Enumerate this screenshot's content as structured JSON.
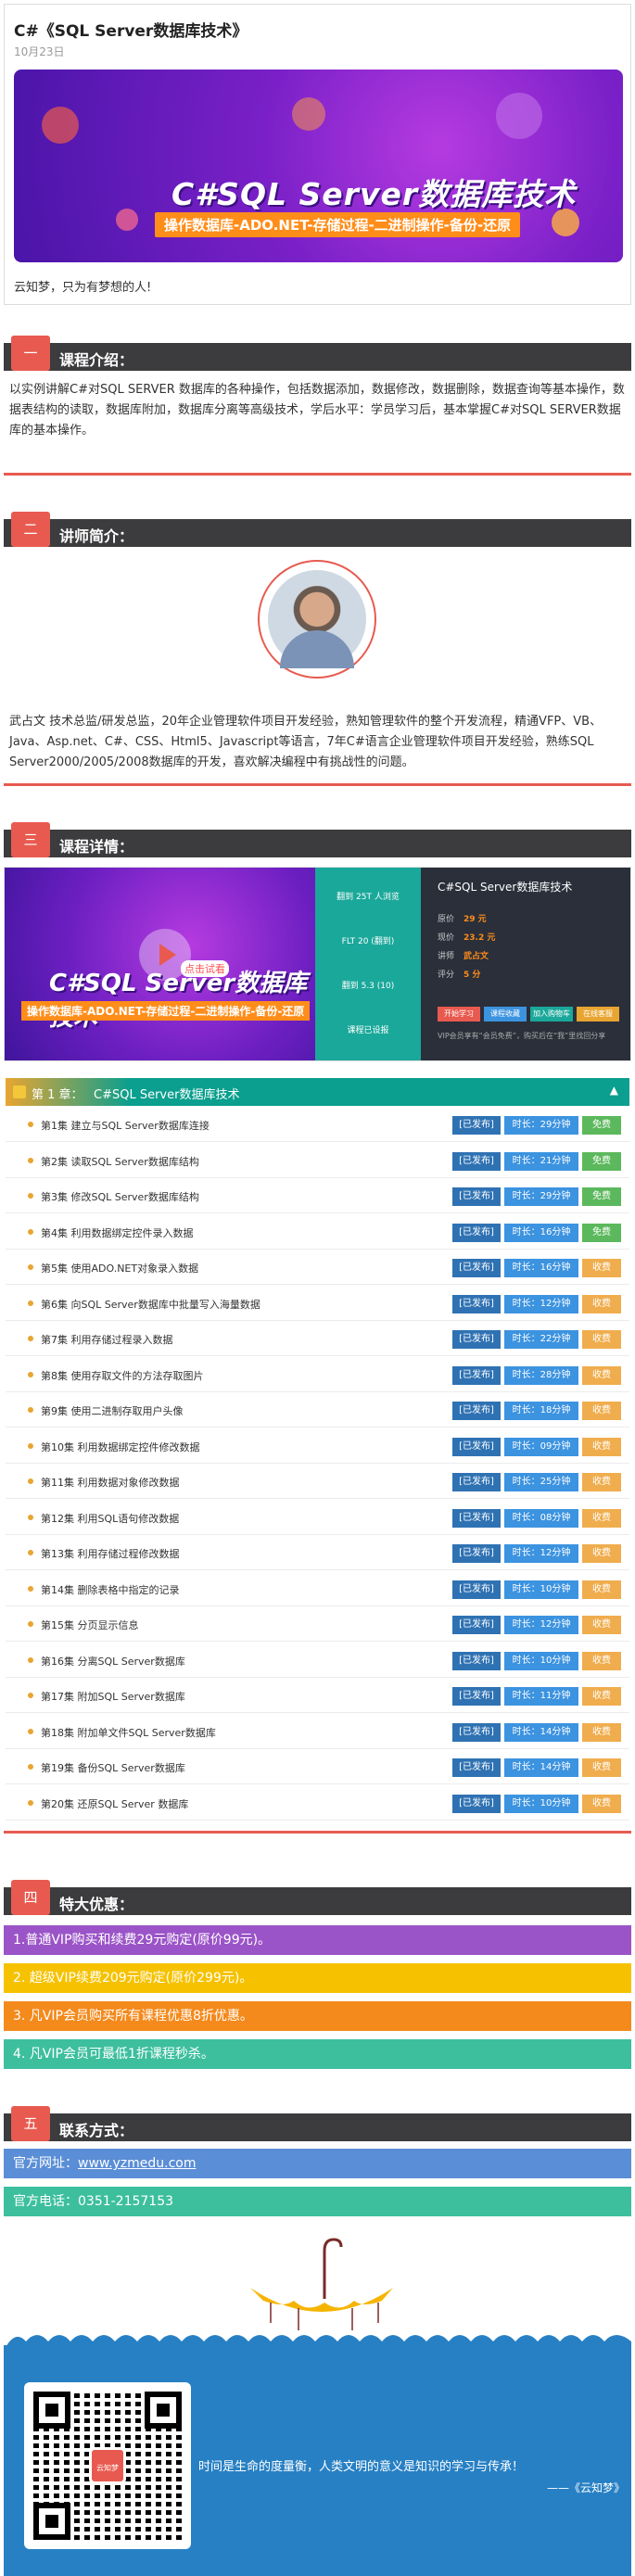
{
  "header": {
    "title": "C#《SQL Server数据库技术》",
    "date": "10月23日",
    "banner_title": "C#SQL Server数据库技术",
    "banner_subtitle": "操作数据库-ADO.NET-存储过程-二进制操作-备份-还原",
    "signature": "云知梦，只为有梦想的人!"
  },
  "sections": {
    "intro": {
      "num": "一",
      "title": "课程介绍：",
      "text": "以实例讲解C#对SQL SERVER 数据库的各种操作，包括数据添加，数据修改，数据删除，数据查询等基本操作，数据表结构的读取，数据库附加，数据库分离等高级技术，学后水平：学员学习后，基本掌握C#对SQL SERVER数据库的基本操作。"
    },
    "teacher": {
      "num": "二",
      "title": "讲师简介：",
      "text": "武占文 技术总监/研发总监，20年企业管理软件项目开发经验，熟知管理软件的整个开发流程，精通VFP、VB、Java、Asp.net、C#、CSS、Html5、Javascript等语言，7年C#语言企业管理软件项目开发经验，熟练SQL Server2000/2005/2008数据库的开发，喜欢解决编程中有挑战性的问题。"
    },
    "detail": {
      "num": "三",
      "title": "课程详情："
    },
    "offers": {
      "num": "四",
      "title": "特大优惠："
    },
    "contact": {
      "num": "五",
      "title": "联系方式："
    }
  },
  "course_card": {
    "banner_title": "C#SQL Server数据库技术",
    "banner_subtitle": "操作数据库-ADO.NET-存储过程-二进制操作-备份-还原",
    "try_label": "点击试看",
    "mid_items": [
      "翻到 25T 人浏览",
      "FLT 20 (翻到)",
      "翻到 5.3 (10)",
      "课程已设报"
    ],
    "name": "C#SQL Server数据库技术",
    "rows": [
      {
        "k": "原价",
        "v": "29 元"
      },
      {
        "k": "现价",
        "v": "23.2 元"
      },
      {
        "k": "讲师",
        "v": "武占文"
      },
      {
        "k": "评分",
        "v": "5 分"
      }
    ],
    "buttons": [
      {
        "label": "开始学习",
        "color": "#e85a4f"
      },
      {
        "label": "课程收藏",
        "color": "#3c93e0"
      },
      {
        "label": "加入购物车",
        "color": "#1aa89a"
      },
      {
        "label": "在线客服",
        "color": "#e8a531"
      }
    ],
    "note": "VIP会员享有“会员免费”，购买后在“我”里找回分享"
  },
  "chapter": {
    "label": "第 1 章：",
    "title": "C#SQL Server数据库技术",
    "arrow": "▲",
    "status_label": "[已发布]",
    "episodes": [
      {
        "label": "第1集 建立与SQL Server数据库连接",
        "dur": "时长：29分钟",
        "tag": "免费",
        "tagc": "#5cb85c"
      },
      {
        "label": "第2集 读取SQL Server数据库结构",
        "dur": "时长：21分钟",
        "tag": "免费",
        "tagc": "#5cb85c"
      },
      {
        "label": "第3集 修改SQL Server数据库结构",
        "dur": "时长：29分钟",
        "tag": "免费",
        "tagc": "#5cb85c"
      },
      {
        "label": "第4集 利用数据绑定控件录入数据",
        "dur": "时长：16分钟",
        "tag": "免费",
        "tagc": "#5cb85c"
      },
      {
        "label": "第5集 使用ADO.NET对象录入数据",
        "dur": "时长：16分钟",
        "tag": "收费",
        "tagc": "#f0ad4e"
      },
      {
        "label": "第6集 向SQL Server数据库中批量写入海量数据",
        "dur": "时长：12分钟",
        "tag": "收费",
        "tagc": "#f0ad4e"
      },
      {
        "label": "第7集 利用存储过程录入数据",
        "dur": "时长：22分钟",
        "tag": "收费",
        "tagc": "#f0ad4e"
      },
      {
        "label": "第8集 使用存取文件的方法存取图片",
        "dur": "时长：28分钟",
        "tag": "收费",
        "tagc": "#f0ad4e"
      },
      {
        "label": "第9集 使用二进制存取用户头像",
        "dur": "时长：18分钟",
        "tag": "收费",
        "tagc": "#f0ad4e"
      },
      {
        "label": "第10集 利用数据绑定控件修改数据",
        "dur": "时长：09分钟",
        "tag": "收费",
        "tagc": "#f0ad4e"
      },
      {
        "label": "第11集 利用数据对象修改数据",
        "dur": "时长：25分钟",
        "tag": "收费",
        "tagc": "#f0ad4e"
      },
      {
        "label": "第12集 利用SQL语句修改数据",
        "dur": "时长：08分钟",
        "tag": "收费",
        "tagc": "#f0ad4e"
      },
      {
        "label": "第13集 利用存储过程修改数据",
        "dur": "时长：12分钟",
        "tag": "收费",
        "tagc": "#f0ad4e"
      },
      {
        "label": "第14集 删除表格中指定的记录",
        "dur": "时长：10分钟",
        "tag": "收费",
        "tagc": "#f0ad4e"
      },
      {
        "label": "第15集 分页显示信息",
        "dur": "时长：12分钟",
        "tag": "收费",
        "tagc": "#f0ad4e"
      },
      {
        "label": "第16集 分离SQL Server数据库",
        "dur": "时长：10分钟",
        "tag": "收费",
        "tagc": "#f0ad4e"
      },
      {
        "label": "第17集 附加SQL Server数据库",
        "dur": "时长：11分钟",
        "tag": "收费",
        "tagc": "#f0ad4e"
      },
      {
        "label": "第18集 附加单文件SQL Server数据库",
        "dur": "时长：14分钟",
        "tag": "收费",
        "tagc": "#f0ad4e"
      },
      {
        "label": "第19集 备份SQL Server数据库",
        "dur": "时长：14分钟",
        "tag": "收费",
        "tagc": "#f0ad4e"
      },
      {
        "label": "第20集 还原SQL Server 数据库",
        "dur": "时长：10分钟",
        "tag": "收费",
        "tagc": "#f0ad4e"
      }
    ]
  },
  "offers": [
    {
      "text": "1.普通VIP购买和续费29元购定(原价99元)。",
      "color": "#9b54c8"
    },
    {
      "text": "2. 超级VIP续费209元购定(原价299元)。",
      "color": "#f6c200"
    },
    {
      "text": "3. 凡VIP会员购买所有课程优惠8折优惠。",
      "color": "#f48a1c"
    },
    {
      "text": "4. 凡VIP会员可最低1折课程秒杀。",
      "color": "#3dbf9e"
    }
  ],
  "contact": {
    "site_label": "官方网址：",
    "site": "www.yzmedu.com",
    "phone_label": "官方电话：",
    "phone": "0351-2157153",
    "site_color": "#5a8ed6",
    "phone_color": "#3dbf9e"
  },
  "footer": {
    "qr_logo": "云知梦",
    "quote": "时间是生命的度量衡，人类文明的意义是知识的学习与传承！",
    "quote_by": "——《云知梦》"
  }
}
